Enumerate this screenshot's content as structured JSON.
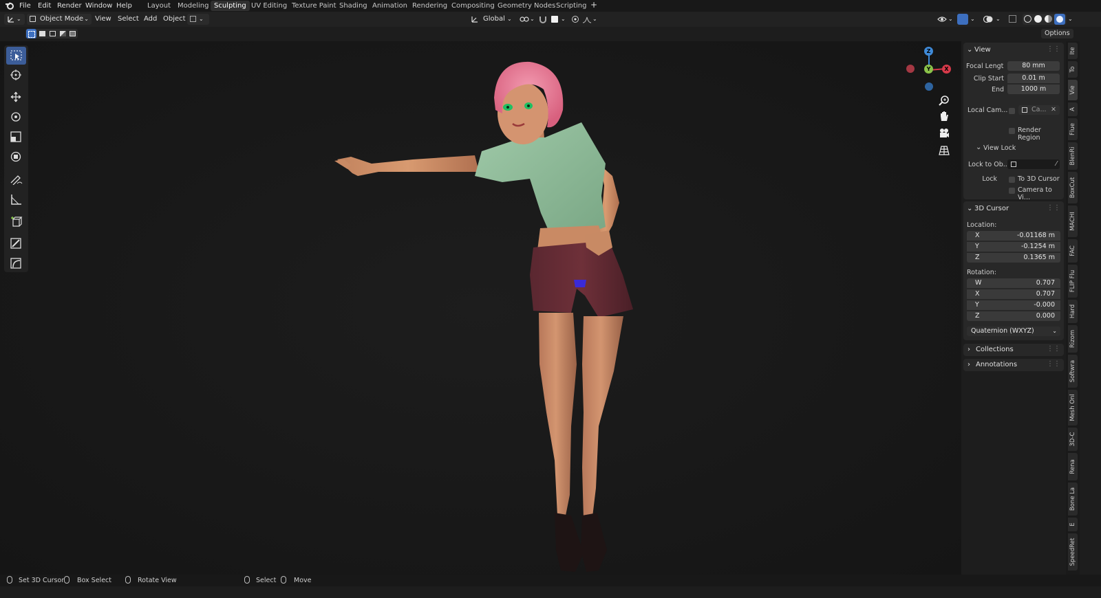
{
  "menu": {
    "file": "File",
    "edit": "Edit",
    "render": "Render",
    "window": "Window",
    "help": "Help"
  },
  "workspaces": [
    "Layout",
    "Modeling",
    "Sculpting",
    "UV Editing",
    "Texture Paint",
    "Shading",
    "Animation",
    "Rendering",
    "Compositing",
    "Geometry Nodes",
    "Scripting"
  ],
  "active_workspace": "Sculpting",
  "header": {
    "mode": "Object Mode",
    "view": "View",
    "select": "Select",
    "add": "Add",
    "object": "Object",
    "transform_orientation": "Global",
    "options": "Options"
  },
  "gizmo": {
    "z": "Z",
    "y": "Y",
    "x": "X"
  },
  "npanel": {
    "view": {
      "title": "View",
      "focal_label": "Focal Lengt",
      "focal_value": "80 mm",
      "clip_start_label": "Clip Start",
      "clip_start_value": "0.01 m",
      "end_label": "End",
      "end_value": "1000 m",
      "local_camera_label": "Local Cam...",
      "local_camera_value": "Ca...",
      "render_region": "Render Region",
      "view_lock_title": "View Lock",
      "lock_to_object_label": "Lock to Ob...",
      "lock_label": "Lock",
      "to_3d_cursor": "To 3D Cursor",
      "camera_to_view": "Camera to Vi..."
    },
    "cursor": {
      "title": "3D Cursor",
      "location_label": "Location:",
      "loc": [
        {
          "axis": "X",
          "value": "-0.01168 m"
        },
        {
          "axis": "Y",
          "value": "-0.1254 m"
        },
        {
          "axis": "Z",
          "value": "0.1365 m"
        }
      ],
      "rotation_label": "Rotation:",
      "rot": [
        {
          "axis": "W",
          "value": "0.707"
        },
        {
          "axis": "X",
          "value": "0.707"
        },
        {
          "axis": "Y",
          "value": "-0.000"
        },
        {
          "axis": "Z",
          "value": "0.000"
        }
      ],
      "rotation_mode": "Quaternion (WXYZ)"
    },
    "collections": "Collections",
    "annotations": "Annotations"
  },
  "side_tabs": [
    "Ite",
    "To",
    "Vie",
    "A",
    "Flue",
    "BlenRi",
    "BoxCut",
    "MACHI",
    "FAC",
    "FLIP Flu",
    "Hard",
    "Rizom",
    "Softwra",
    "Mesh Onl",
    "3D-C",
    "Rena",
    "Bone La",
    "E",
    "SpeedRet"
  ],
  "status": {
    "set_cursor": "Set 3D Cursor",
    "box_select": "Box Select",
    "rotate_view": "Rotate View",
    "select": "Select",
    "move": "Move"
  },
  "colors": {
    "accent": "#4772b3",
    "active_tool": "#3c5d99",
    "gizmo_x": "#d63a4a",
    "gizmo_y": "#8bc34a",
    "gizmo_z": "#3f8ad8"
  }
}
